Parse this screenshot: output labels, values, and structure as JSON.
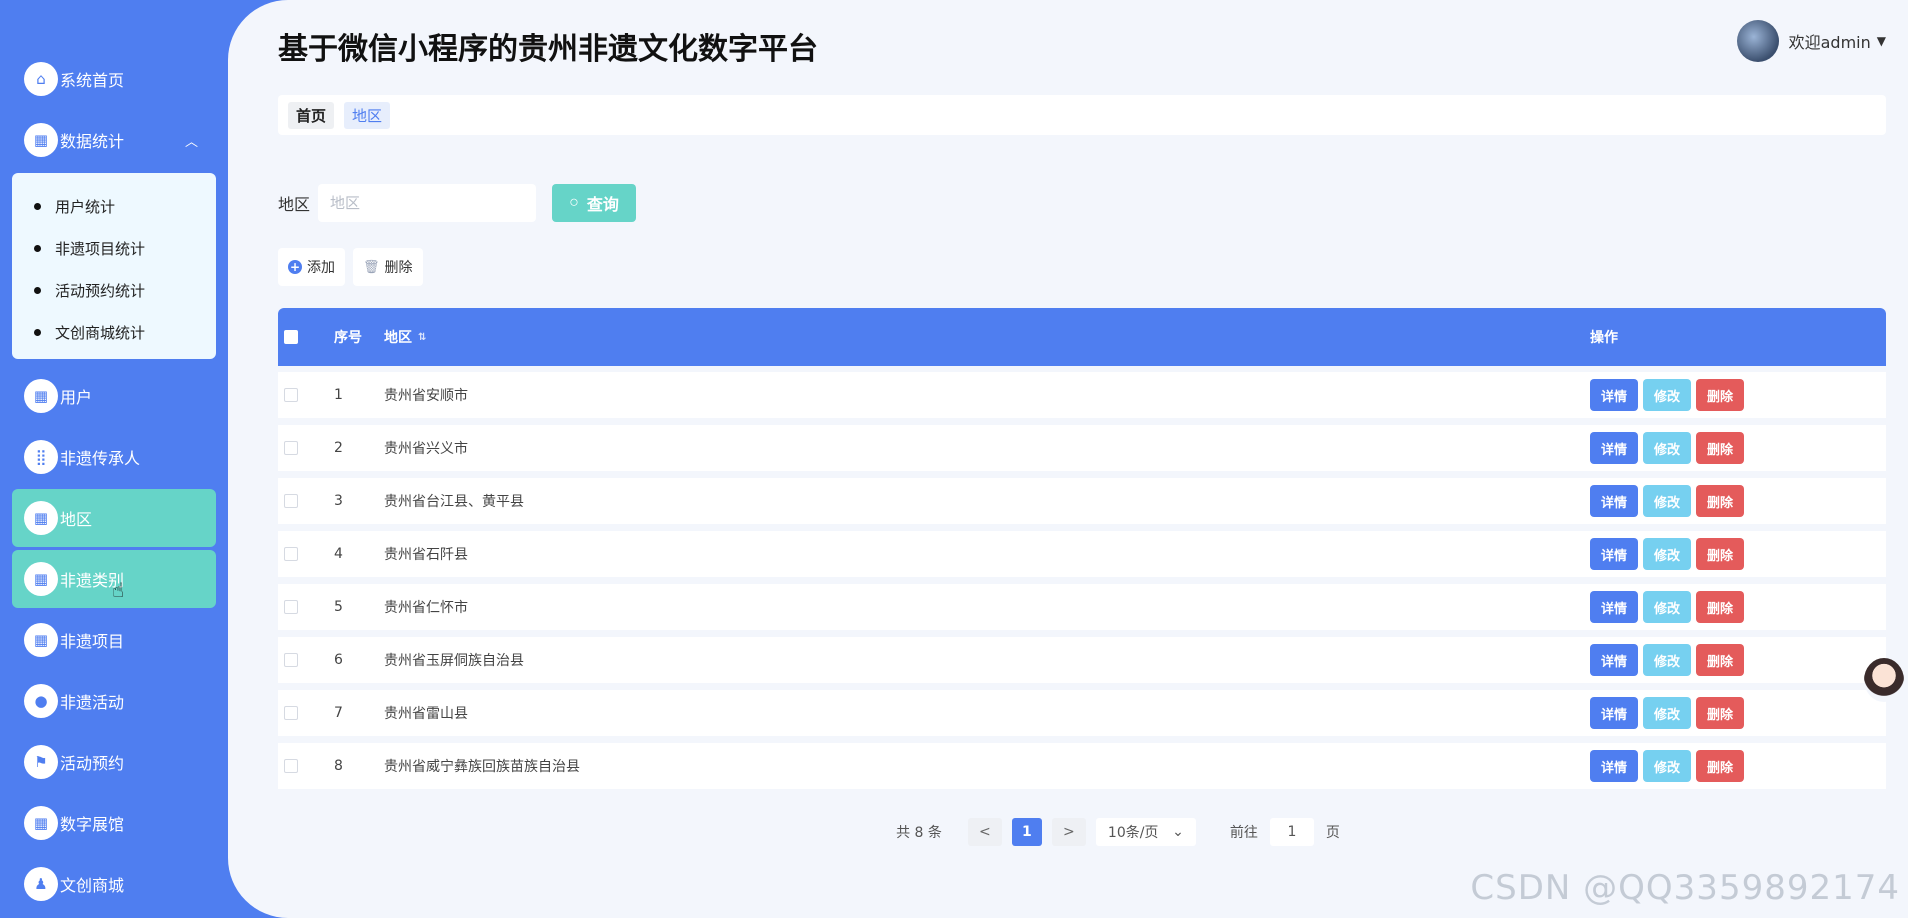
{
  "sidebar": {
    "items": [
      {
        "label": "系统首页",
        "icon": "home-icon"
      },
      {
        "label": "数据统计",
        "icon": "grid-icon",
        "expanded": true
      },
      {
        "label": "用户",
        "icon": "grid-icon"
      },
      {
        "label": "非遗传承人",
        "icon": "apps-icon"
      },
      {
        "label": "地区",
        "icon": "grid-icon",
        "active": true
      },
      {
        "label": "非遗类别",
        "icon": "grid-icon",
        "hover": true
      },
      {
        "label": "非遗项目",
        "icon": "grid-icon"
      },
      {
        "label": "非遗活动",
        "icon": "user-icon"
      },
      {
        "label": "活动预约",
        "icon": "flag-icon"
      },
      {
        "label": "数字展馆",
        "icon": "grid-icon"
      },
      {
        "label": "文创商城",
        "icon": "stamp-icon"
      }
    ],
    "submenu": [
      "用户统计",
      "非遗项目统计",
      "活动预约统计",
      "文创商城统计"
    ],
    "active_color": "#66d4c8",
    "bg_color": "#4f7ef0"
  },
  "header": {
    "title": "基于微信小程序的贵州非遗文化数字平台",
    "welcome": "欢迎admin"
  },
  "breadcrumb": {
    "home": "首页",
    "current": "地区"
  },
  "search": {
    "label": "地区",
    "placeholder": "地区",
    "button": "查询"
  },
  "actions": {
    "add": "添加",
    "delete": "删除"
  },
  "table": {
    "headers": {
      "index": "序号",
      "region": "地区",
      "ops": "操作"
    },
    "rows": [
      {
        "index": "1",
        "region": "贵州省安顺市"
      },
      {
        "index": "2",
        "region": "贵州省兴义市"
      },
      {
        "index": "3",
        "region": "贵州省台江县、黄平县"
      },
      {
        "index": "4",
        "region": "贵州省石阡县"
      },
      {
        "index": "5",
        "region": "贵州省仁怀市"
      },
      {
        "index": "6",
        "region": "贵州省玉屏侗族自治县"
      },
      {
        "index": "7",
        "region": "贵州省雷山县"
      },
      {
        "index": "8",
        "region": "贵州省威宁彝族回族苗族自治县"
      }
    ],
    "op_labels": {
      "detail": "详情",
      "edit": "修改",
      "remove": "删除"
    }
  },
  "pagination": {
    "total": "共 8 条",
    "prev": "<",
    "current": "1",
    "next": ">",
    "page_size": "10条/页",
    "goto_label": "前往",
    "goto_value": "1",
    "goto_suffix": "页"
  },
  "watermark": "CSDN @QQ3359892174"
}
